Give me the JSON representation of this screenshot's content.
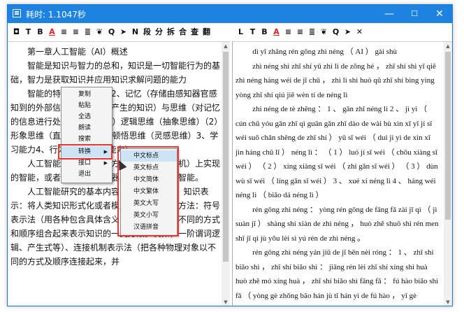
{
  "window": {
    "title": "耗时: 1.1047秒",
    "controls": {
      "minimize": "—",
      "maximize": "☐",
      "close": "✕"
    }
  },
  "left_toolbar": [
    "◘",
    "T",
    "B",
    "A",
    "≡",
    "≡",
    "≣",
    "❦",
    "Q",
    "➤",
    "N",
    "段",
    "分",
    "拆",
    "合",
    "查",
    "翻"
  ],
  "right_toolbar": [
    "L",
    "T",
    "B",
    "A",
    "≡",
    "≡",
    "≣",
    "❦",
    "Q",
    "➤",
    "✕"
  ],
  "left_text": [
    "第一章人工智能（AI）概述",
    "智能是知识与智力的总和，知识是一切智能行为的基础，智力是获取知识并应用知识求解问题的能力",
    "智能的特征：感知能力2、记忆（存储由感知器官感知到的外部信息和由思维所产生的知识）与思维（对记忆的信息进行处理）能力：（1）逻辑思维（抽象思维）（2）形象思维（直感思维）（3）顿悟思维（灵感思维）3、学习能力4、行为能力（表达能力）",
    "人工智能：是用人工的方法在机器（计算机）上实现的智能，或者说是人们使机器具有类似于人的智能。",
    "人工智能研究的基本内容：1、知识表示：知识表示：将人类知识形式化或者模型化。知识表示方法：符号表示法（用各种包含具体含义的符号，以各种不同的方式和顺序组合起来表示知识的一类方法。例如，一阶谓词逻辑、产生式等）、连接机制表示法（把各种物理对象以不同的方式及顺序连接起来，并"
  ],
  "right_text": [
    "dì yī zhāng rén gōng zhì néng （ AI ） gài shù",
    "zhì néng shì zhī shí yǔ zhì lì de zǒng hé ， zhī shí shì yī qiē zhì néng háng wéi de jī chǔ ， zhì lì shì huò qǔ zhī shí bìng yìng yòng zhī shí qiú jiě wèn tí de néng lì",
    "zhì néng de tè zhēng ： 1 、 gǎn zhī néng lì 2 、 jì yì （ cún chǔ yóu gǎn zhī qì guān gǎn zhī dào de wài bù xìn xī yǐ jí sī wéi suǒ chǎn shēng de zhī shí ） yǔ sī wéi （ duì jì yì de xìn xī jìn háng chǔ lǐ ） néng lì ： （ 1 ） luó jí sī wéi （ chōu xiàng sī wéi ） （ 2 ） xíng xiàng sī wéi （ zhí gǎn sī wéi ） （ 3 ） dùn wù sī wéi （ líng gǎn sī wéi ） 3 、 xué xí néng lì 4 、 háng wéi néng lì （ biǎo dá néng lì ）",
    "rén gōng zhì néng ： yòng rén gōng de fāng fǎ zài jī qì （ jì suàn jī ） shàng shí xiàn de zhì néng ， huò zhě shuō shì rén men shǐ jī qì jù yǒu lèi sì yú rén de zhì néng 。",
    "rén gōng zhì néng yán jiū de jī běn nèi róng ： 1 、 zhī shí biǎo shì ， zhī shí biǎo shì ： jiāng rén lèi zhī shí xíng shì huà huò zhě mó xíng huà ， zhī shí biǎo shì fāng fǎ ： fú hào biǎo shì fǎ （ yòng gè zhǒng bāo hán jù tǐ hán yì de fú hào ， yǐ gè"
  ],
  "context_menu": {
    "items": [
      "复制",
      "粘贴",
      "全选",
      "朗读",
      "搜索",
      "转换",
      "接口",
      "退出"
    ],
    "highlighted": "转换"
  },
  "submenu": {
    "items": [
      "中文标点",
      "英文标点",
      "中文简体",
      "中文繁体",
      "英文大写",
      "英文小写",
      "汉语拼音"
    ],
    "highlighted": "中文标点"
  },
  "colors": {
    "titlebar": "#1e82e0",
    "highlight": "#cde4f7",
    "annotation": "#e33333"
  }
}
